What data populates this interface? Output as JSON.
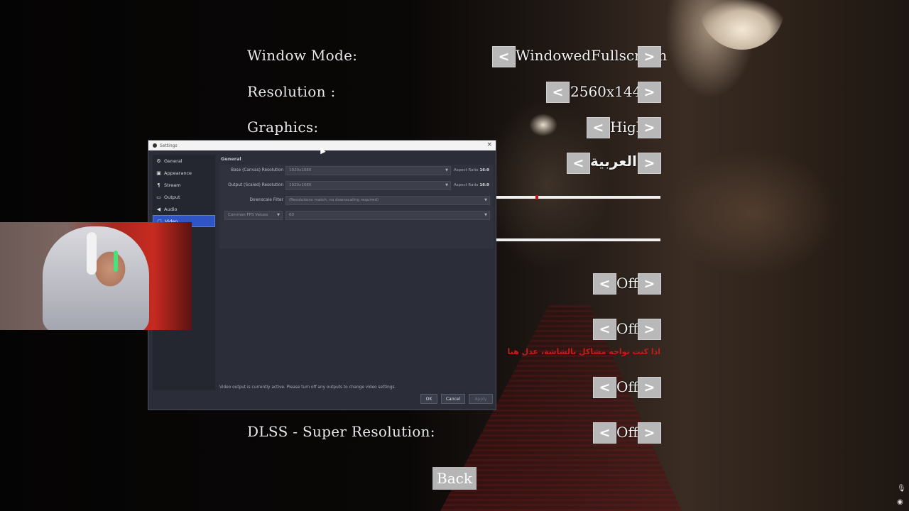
{
  "game_menu": {
    "window_mode": {
      "label": "Window Mode:",
      "value": "WindowedFullscreen"
    },
    "resolution": {
      "label": "Resolution :",
      "value": "2560x1440"
    },
    "graphics": {
      "label": "Graphics:",
      "value": "High"
    },
    "language": {
      "value": "العربية"
    },
    "brightness_slider": {
      "level": 0.24
    },
    "volume_slider": {
      "level": 1.0
    },
    "toggle_1": {
      "value": "Off"
    },
    "toggle_2": {
      "value": "Off"
    },
    "warning_text": "اذا كنت تواجه مشاكل بالشاشة، عدل هنا",
    "toggle_3": {
      "value": "Off"
    },
    "dlss": {
      "label": "DLSS - Super Resolution:",
      "value": "Off"
    },
    "arrow_left": "<",
    "arrow_right": ">",
    "back_button": "Back"
  },
  "obs_settings": {
    "window_title": "Settings",
    "close_glyph": "×",
    "sidebar": [
      {
        "label": "General",
        "icon": "gear-icon",
        "glyph": "⚙"
      },
      {
        "label": "Appearance",
        "icon": "palette-icon",
        "glyph": "▣"
      },
      {
        "label": "Stream",
        "icon": "antenna-icon",
        "glyph": "¶"
      },
      {
        "label": "Output",
        "icon": "monitor-icon",
        "glyph": "▭"
      },
      {
        "label": "Audio",
        "icon": "speaker-icon",
        "glyph": "◀"
      },
      {
        "label": "Video",
        "icon": "video-icon",
        "glyph": "▢"
      }
    ],
    "section_title": "General",
    "base_resolution": {
      "label": "Base (Canvas) Resolution",
      "value": "1920x1080",
      "aspect_label": "Aspect Ratio",
      "aspect_value": "16:9"
    },
    "output_resolution": {
      "label": "Output (Scaled) Resolution",
      "value": "1920x1080",
      "aspect_label": "Aspect Ratio",
      "aspect_value": "16:9"
    },
    "downscale_filter": {
      "label": "Downscale Filter",
      "value": "(Resolutions match, no downscaling required)"
    },
    "fps": {
      "type_value": "Common FPS Values",
      "value": "60"
    },
    "status_message": "Video output is currently active. Please turn off any outputs to change video settings.",
    "buttons": {
      "ok": "OK",
      "cancel": "Cancel",
      "apply": "Apply"
    }
  },
  "tray": {
    "mic_icon": "microphone-icon",
    "settings_icon": "target-icon"
  }
}
